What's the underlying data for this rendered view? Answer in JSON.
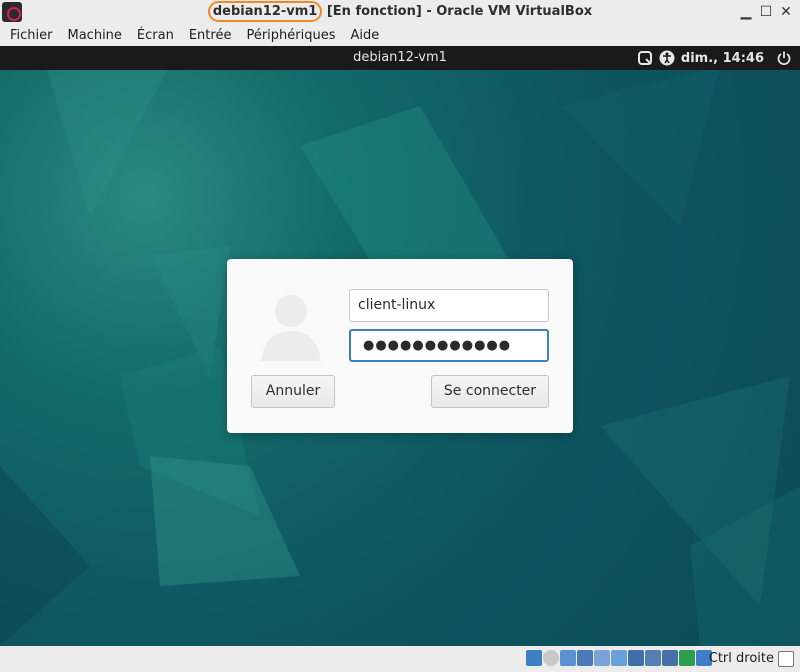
{
  "window": {
    "title_vm": "debian12-vm1",
    "title_rest": " [En fonction] - Oracle VM VirtualBox",
    "controls": [
      "minimize-icon",
      "maximize-icon",
      "close-icon"
    ]
  },
  "menu": {
    "items": [
      "Fichier",
      "Machine",
      "Écran",
      "Entrée",
      "Périphériques",
      "Aide"
    ]
  },
  "guest": {
    "topbar_title": "debian12-vm1",
    "clock": "dim., 14:46",
    "icons": [
      "accessibility-icon",
      "network-icon",
      "power-icon"
    ]
  },
  "login": {
    "username": "client-linux",
    "password_mask": "●●●●●●●●●●●●",
    "cancel_label": "Annuler",
    "connect_label": "Se connecter",
    "avatar_icon": "user-avatar-icon"
  },
  "statusbar": {
    "host_key": "Ctrl droite"
  },
  "colors": {
    "accent_highlight": "#f08a24",
    "focus_border": "#3b7fc4",
    "desktop_bg": "#0e5660"
  }
}
